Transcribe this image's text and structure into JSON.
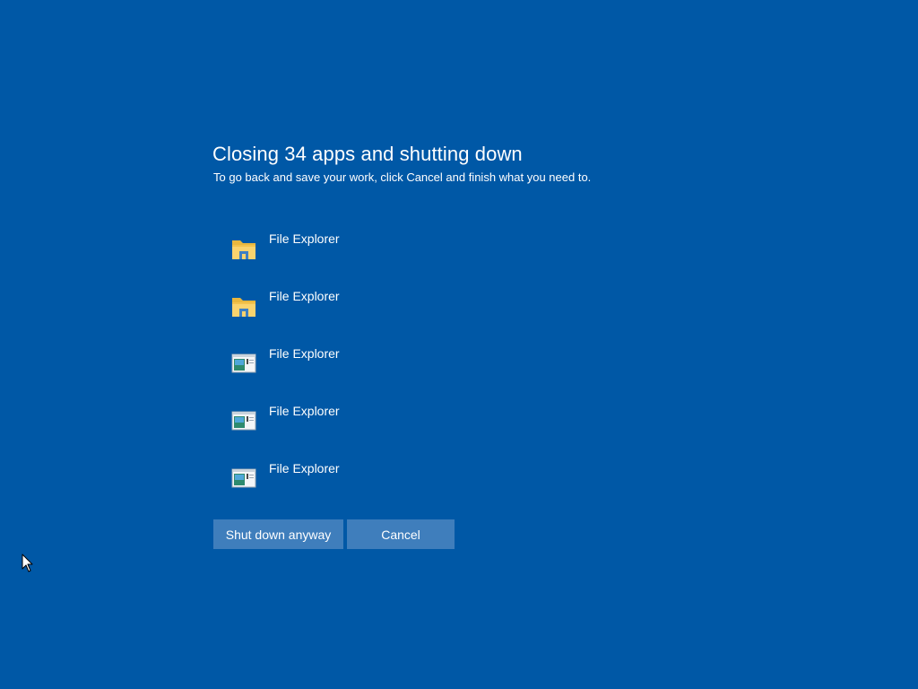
{
  "dialog": {
    "title": "Closing 34 apps and shutting down",
    "subtitle": "To go back and save your work, click Cancel and finish what you need to."
  },
  "apps": [
    {
      "name": "File Explorer",
      "icon": "folder-icon"
    },
    {
      "name": "File Explorer",
      "icon": "folder-icon"
    },
    {
      "name": "File Explorer",
      "icon": "window-icon"
    },
    {
      "name": "File Explorer",
      "icon": "window-icon"
    },
    {
      "name": "File Explorer",
      "icon": "window-icon"
    }
  ],
  "buttons": {
    "shutdown_label": "Shut down anyway",
    "cancel_label": "Cancel"
  },
  "colors": {
    "background": "#0058A6",
    "button": "#3F7EBC",
    "text": "#FFFFFF"
  }
}
